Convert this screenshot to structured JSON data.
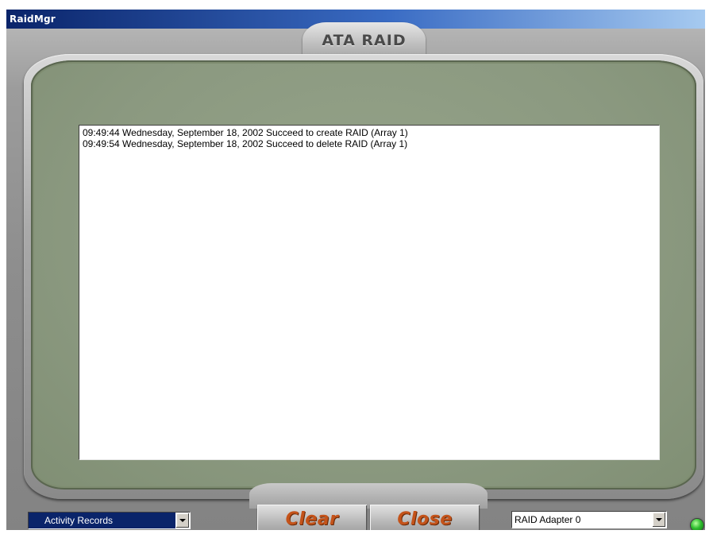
{
  "window": {
    "title": "RaidMgr"
  },
  "logo": {
    "text": "ATA RAID"
  },
  "log": {
    "entries": [
      "09:49:44 Wednesday, September 18, 2002 Succeed to create RAID (Array 1)",
      "09:49:54 Wednesday, September 18, 2002 Succeed to delete RAID (Array 1)"
    ]
  },
  "controls": {
    "view_select": "Activity Records",
    "clear_label": "Clear",
    "close_label": "Close",
    "adapter_select": "RAID Adapter 0"
  },
  "status": {
    "led_color": "#2fbd2f"
  },
  "colors": {
    "title_bar": "#0a246a",
    "bezel_green": "#8b9980",
    "button_text": "#c4531a"
  }
}
